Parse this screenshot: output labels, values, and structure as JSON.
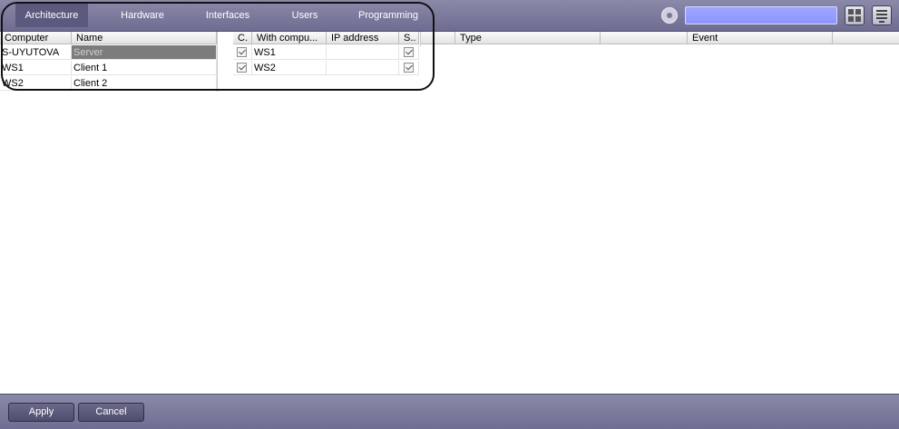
{
  "tabs": [
    {
      "label": "Architecture",
      "active": true
    },
    {
      "label": "Hardware"
    },
    {
      "label": "Interfaces"
    },
    {
      "label": "Users"
    },
    {
      "label": "Programming"
    }
  ],
  "search": {
    "value": ""
  },
  "icons": {
    "settings": "gear-icon",
    "layout": "grid-icon",
    "menu": "menu-icon"
  },
  "computers_table": {
    "headers": [
      "Computer",
      "Name"
    ],
    "rows": [
      {
        "computer": "S-UYUTOVA",
        "name": "Server",
        "selected": true
      },
      {
        "computer": "WS1",
        "name": "Client 1"
      },
      {
        "computer": "WS2",
        "name": "Client 2"
      }
    ]
  },
  "connections_table": {
    "headers": [
      "C.",
      "With compu...",
      "IP address",
      "S.."
    ],
    "rows": [
      {
        "checked": true,
        "with_computer": "WS1",
        "ip": "",
        "s_checked": true
      },
      {
        "checked": true,
        "with_computer": "WS2",
        "ip": "",
        "s_checked": true
      }
    ]
  },
  "events_table": {
    "headers": [
      "Type",
      "",
      "Event"
    ]
  },
  "buttons": {
    "apply": "Apply",
    "cancel": "Cancel"
  },
  "colors": {
    "toolbar": "#7c7b9f",
    "active_tab": "#5b5a7e",
    "search_bg": "#959dff",
    "selected_row": "#7c7c7c"
  }
}
